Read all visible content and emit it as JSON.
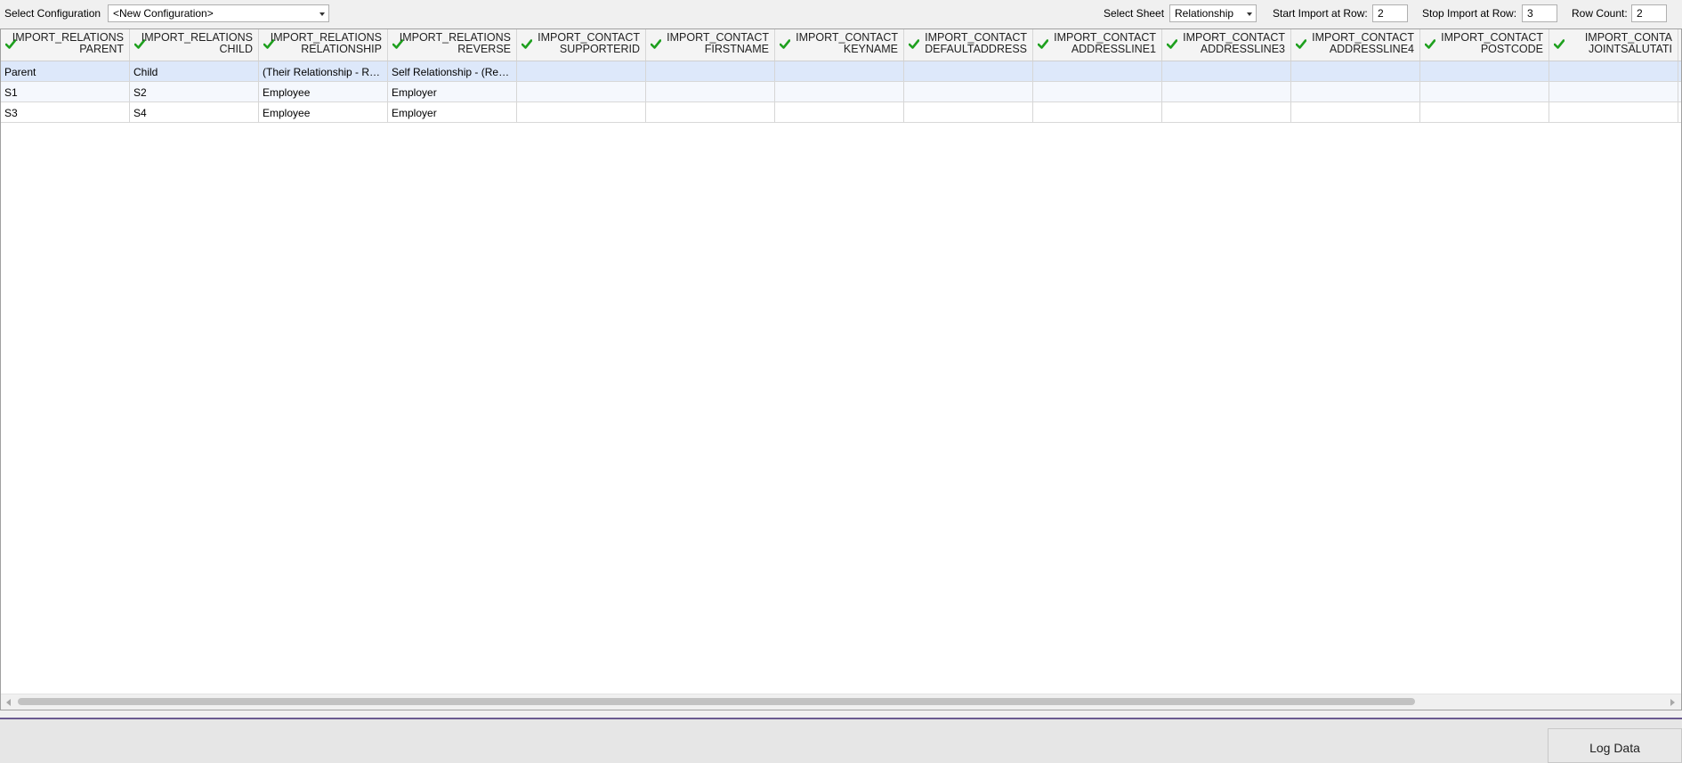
{
  "toolbar": {
    "select_configuration_label": "Select Configuration",
    "configuration_value": "<New Configuration>",
    "select_sheet_label": "Select Sheet",
    "sheet_value": "Relationship",
    "start_row_label": "Start Import at Row:",
    "start_row_value": "2",
    "stop_row_label": "Stop Import at Row:",
    "stop_row_value": "3",
    "row_count_label": "Row Count:",
    "row_count_value": "2"
  },
  "grid": {
    "columns": [
      {
        "line1": "IMPORT_RELATIONS",
        "line2": "PARENT"
      },
      {
        "line1": "IMPORT_RELATIONS",
        "line2": "CHILD"
      },
      {
        "line1": "IMPORT_RELATIONS",
        "line2": "RELATIONSHIP"
      },
      {
        "line1": "IMPORT_RELATIONS",
        "line2": "REVERSE"
      },
      {
        "line1": "IMPORT_CONTACT",
        "line2": "SUPPORTERID"
      },
      {
        "line1": "IMPORT_CONTACT",
        "line2": "FIRSTNAME"
      },
      {
        "line1": "IMPORT_CONTACT",
        "line2": "KEYNAME"
      },
      {
        "line1": "IMPORT_CONTACT",
        "line2": "DEFAULTADDRESS"
      },
      {
        "line1": "IMPORT_CONTACT",
        "line2": "ADDRESSLINE1"
      },
      {
        "line1": "IMPORT_CONTACT",
        "line2": "ADDRESSLINE3"
      },
      {
        "line1": "IMPORT_CONTACT",
        "line2": "ADDRESSLINE4"
      },
      {
        "line1": "IMPORT_CONTACT",
        "line2": "POSTCODE"
      },
      {
        "line1": "IMPORT_CONTA",
        "line2": "JOINTSALUTATI"
      }
    ],
    "rows": [
      [
        "Parent",
        "Child",
        " (Their Relationship - Relationship)",
        "Self Relationship - (Reverse)",
        "",
        "",
        "",
        "",
        "",
        "",
        "",
        "",
        ""
      ],
      [
        "S1",
        "S2",
        "Employee",
        "Employer",
        "",
        "",
        "",
        "",
        "",
        "",
        "",
        "",
        ""
      ],
      [
        "S3",
        "S4",
        "Employee",
        "Employer",
        "",
        "",
        "",
        "",
        "",
        "",
        "",
        "",
        ""
      ]
    ]
  },
  "icons": {
    "column_mapped": "check-icon",
    "check_color": "#1fa01f"
  },
  "footer": {
    "log_data_label": "Log Data"
  }
}
